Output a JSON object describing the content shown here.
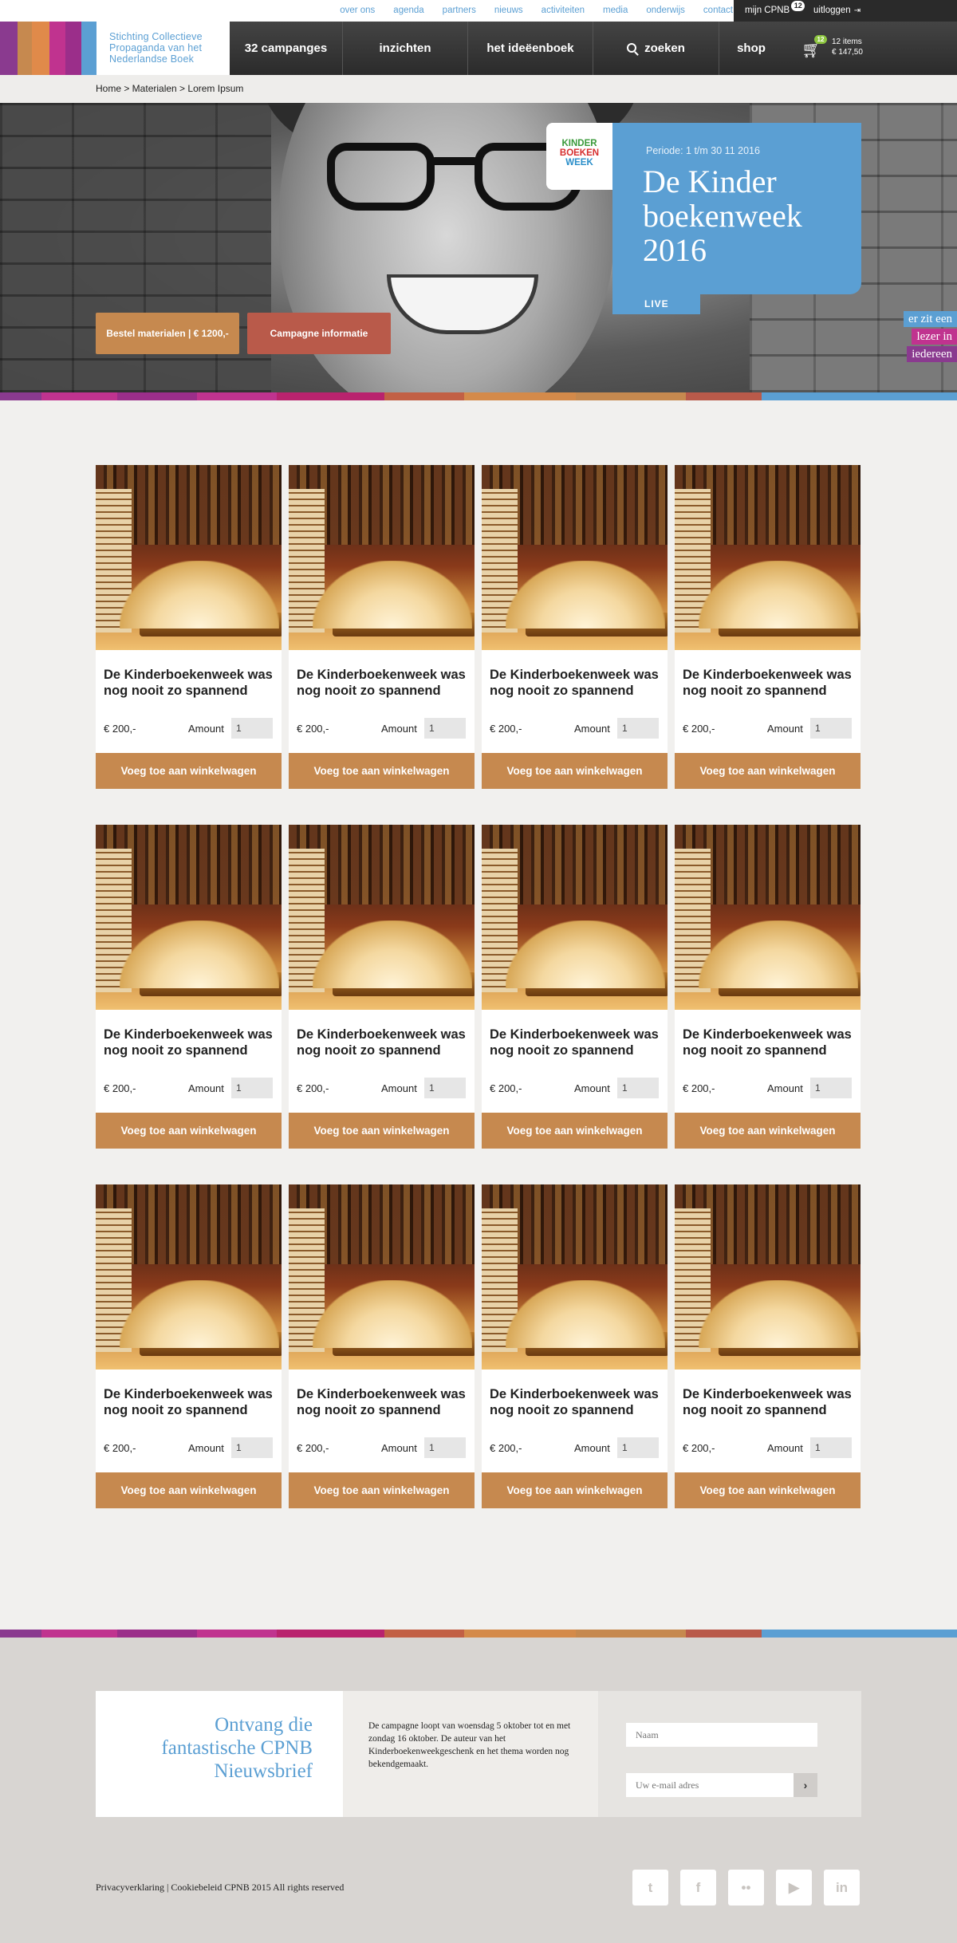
{
  "topbar": {
    "links": [
      "over ons",
      "agenda",
      "partners",
      "nieuws",
      "activiteiten",
      "media",
      "onderwijs",
      "contact"
    ],
    "account": "mijn CPNB",
    "account_badge": "12",
    "logout": "uitloggen"
  },
  "logo": {
    "lines": [
      "Stichting Collectieve",
      "Propaganda van het",
      "Nederlandse Boek"
    ],
    "stripe_colors": [
      "#8a3a8f",
      "#c6894f",
      "#e08a4a",
      "#c0338f",
      "#9b2e8a",
      "#5b9fd3"
    ]
  },
  "nav": {
    "items": [
      "32 campanges",
      "inzichten",
      "het ideëenboek",
      "zoeken",
      "shop"
    ],
    "cart_badge": "12",
    "cart_items": "12 items",
    "cart_total": "€ 147,50"
  },
  "breadcrumb": "Home > Materialen > Lorem Ipsum",
  "hero": {
    "order_button": "Bestel materialen | € 1200,-",
    "info_button": "Campagne informatie",
    "period": "Periode: 1 t/m 30 11 2016",
    "title_lines": [
      "De Kinder",
      "boekenweek",
      "2016"
    ],
    "logo_lines": [
      "KINDER",
      "BOEKEN",
      "WEEK"
    ],
    "live": "LIVE",
    "slogan": [
      "er zit een",
      "lezer in",
      "iedereen"
    ]
  },
  "colorbar": [
    "#8a3a8f",
    "#c0338f",
    "#9b2e8a",
    "#c0338f",
    "#b9236e",
    "#c26045",
    "#d48a4a",
    "#c6894f",
    "#b95a4a",
    "#5b9fd3"
  ],
  "products": [
    {
      "title": "De Kinderboekenweek was nog nooit zo spannend",
      "price": "€ 200,-",
      "amount_label": "Amount",
      "amount": "1",
      "button": "Voeg toe aan winkelwagen"
    },
    {
      "title": "De Kinderboekenweek was nog nooit zo spannend",
      "price": "€ 200,-",
      "amount_label": "Amount",
      "amount": "1",
      "button": "Voeg toe aan winkelwagen"
    },
    {
      "title": "De Kinderboekenweek was nog nooit zo spannend",
      "price": "€ 200,-",
      "amount_label": "Amount",
      "amount": "1",
      "button": "Voeg toe aan winkelwagen"
    },
    {
      "title": "De Kinderboekenweek was nog nooit zo spannend",
      "price": "€ 200,-",
      "amount_label": "Amount",
      "amount": "1",
      "button": "Voeg toe aan winkelwagen"
    },
    {
      "title": "De Kinderboekenweek was nog nooit zo spannend",
      "price": "€ 200,-",
      "amount_label": "Amount",
      "amount": "1",
      "button": "Voeg toe aan winkelwagen"
    },
    {
      "title": "De Kinderboekenweek was nog nooit zo spannend",
      "price": "€ 200,-",
      "amount_label": "Amount",
      "amount": "1",
      "button": "Voeg toe aan winkelwagen"
    },
    {
      "title": "De Kinderboekenweek was nog nooit zo spannend",
      "price": "€ 200,-",
      "amount_label": "Amount",
      "amount": "1",
      "button": "Voeg toe aan winkelwagen"
    },
    {
      "title": "De Kinderboekenweek was nog nooit zo spannend",
      "price": "€ 200,-",
      "amount_label": "Amount",
      "amount": "1",
      "button": "Voeg toe aan winkelwagen"
    },
    {
      "title": "De Kinderboekenweek was nog nooit zo spannend",
      "price": "€ 200,-",
      "amount_label": "Amount",
      "amount": "1",
      "button": "Voeg toe aan winkelwagen"
    },
    {
      "title": "De Kinderboekenweek was nog nooit zo spannend",
      "price": "€ 200,-",
      "amount_label": "Amount",
      "amount": "1",
      "button": "Voeg toe aan winkelwagen"
    },
    {
      "title": "De Kinderboekenweek was nog nooit zo spannend",
      "price": "€ 200,-",
      "amount_label": "Amount",
      "amount": "1",
      "button": "Voeg toe aan winkelwagen"
    },
    {
      "title": "De Kinderboekenweek was nog nooit zo spannend",
      "price": "€ 200,-",
      "amount_label": "Amount",
      "amount": "1",
      "button": "Voeg toe aan winkelwagen"
    }
  ],
  "newsletter": {
    "heading": "Ontvang die fantastische CPNB Nieuwsbrief",
    "text": "De campagne loopt van woensdag 5 oktober tot en met zondag 16 oktober. De auteur van het Kinderboekenweekgeschenk en het thema worden nog bekendgemaakt.",
    "name_placeholder": "Naam",
    "email_placeholder": "Uw e-mail adres"
  },
  "footer": {
    "legal": "Privacyverklaring | Cookiebeleid  CPNB 2015 All rights reserved",
    "socials": [
      {
        "icon": "twitter-icon",
        "glyph": "t"
      },
      {
        "icon": "facebook-icon",
        "glyph": "f"
      },
      {
        "icon": "flickr-icon",
        "glyph": "••"
      },
      {
        "icon": "youtube-icon",
        "glyph": "▶"
      },
      {
        "icon": "linkedin-icon",
        "glyph": "in"
      }
    ]
  },
  "colors": {
    "accent_blue": "#5b9fd3",
    "button_orange": "#c6894f",
    "button_red": "#b95a4a"
  }
}
